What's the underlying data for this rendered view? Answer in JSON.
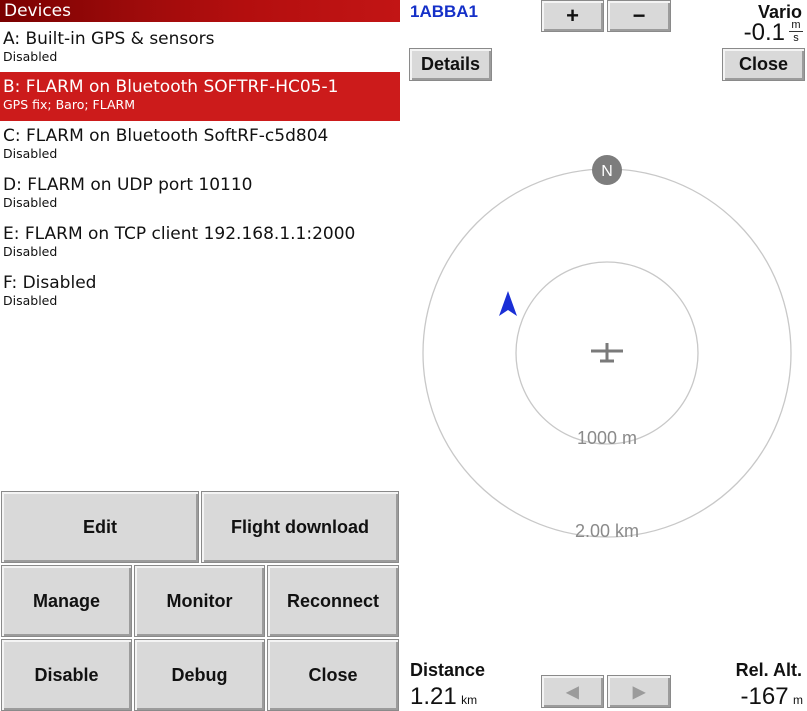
{
  "devices": {
    "title": "Devices",
    "items": [
      {
        "name": "A: Built-in GPS & sensors",
        "status": "Disabled"
      },
      {
        "name": "B: FLARM on Bluetooth SOFTRF-HC05-1",
        "status": "GPS fix; Baro; FLARM",
        "selected": true
      },
      {
        "name": "C: FLARM on Bluetooth SoftRF-c5d804",
        "status": "Disabled"
      },
      {
        "name": "D: FLARM on UDP port 10110",
        "status": "Disabled"
      },
      {
        "name": "E: FLARM on TCP client 192.168.1.1:2000",
        "status": "Disabled"
      },
      {
        "name": "F: Disabled",
        "status": "Disabled"
      }
    ]
  },
  "buttons": {
    "edit": "Edit",
    "flight_download": "Flight download",
    "manage": "Manage",
    "monitor": "Monitor",
    "reconnect": "Reconnect",
    "disable": "Disable",
    "debug": "Debug",
    "close": "Close"
  },
  "traffic": {
    "callsign": "1ABBA1",
    "zoom_in": "+",
    "zoom_out": "−",
    "details": "Details",
    "close": "Close",
    "vario_label": "Vario",
    "vario_value": "-0.1",
    "vario_unit_top": "m",
    "vario_unit_bottom": "s",
    "north": "N",
    "inner_ring": "1000 m",
    "outer_ring": "2.00 km",
    "distance_label": "Distance",
    "distance_value": "1.21",
    "distance_unit": "km",
    "relalt_label": "Rel. Alt.",
    "relalt_value": "-167",
    "relalt_unit": "m",
    "prev": "◀",
    "next": "▶"
  },
  "colors": {
    "selected_row": "#cc1b1b",
    "callsign": "#1530c8",
    "traffic_arrow": "#1a2fd6"
  }
}
